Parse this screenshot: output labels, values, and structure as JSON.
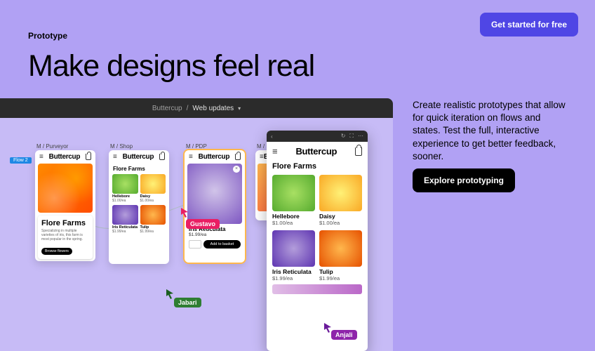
{
  "cta_top": "Get started for free",
  "eyebrow": "Prototype",
  "headline": "Make designs feel real",
  "description": "Create realistic prototypes that allow for quick iteration on flows and states. Test the full, interactive experience to get better feedback, sooner.",
  "cta_explore": "Explore prototyping",
  "canvas": {
    "breadcrumb_root": "Buttercup",
    "breadcrumb_sep": "/",
    "breadcrumb_page": "Web updates",
    "flow_badge": "Flow 2",
    "frames": {
      "purveyor": {
        "label": "M / Purveyor",
        "brand": "Buttercup",
        "card_title": "Flore Farms",
        "card_copy": "Specializing in multiple varieties of iris, this farm is most popular in the spring.",
        "card_cta": "Browse flowers"
      },
      "shop": {
        "label": "M / Shop",
        "brand": "Buttercup",
        "title": "Flore Farms",
        "items": [
          {
            "name": "Hellebore",
            "price": "$1.00/ea"
          },
          {
            "name": "Daisy",
            "price": "$1.00/ea"
          },
          {
            "name": "Iris Reticulata",
            "price": "$1.99/ea"
          },
          {
            "name": "Tulip",
            "price": "$1.99/ea"
          }
        ]
      },
      "pdp": {
        "label": "M / PDP",
        "brand": "Buttercup",
        "product": "Iris Reticulata",
        "price": "$1.99/ea",
        "add_label": "Add to basket"
      },
      "cutoff": {
        "label": "M /",
        "brand": "Bu"
      }
    },
    "cursors": {
      "gustavo": "Gustavo",
      "jabari": "Jabari",
      "anjali": "Anjali"
    }
  },
  "preview": {
    "brand": "Buttercup",
    "title": "Flore Farms",
    "items": [
      {
        "name": "Hellebore",
        "price": "$1.00/ea"
      },
      {
        "name": "Daisy",
        "price": "$1.00/ea"
      },
      {
        "name": "Iris Reticulata",
        "price": "$1.99/ea"
      },
      {
        "name": "Tulip",
        "price": "$1.99/ea"
      }
    ]
  }
}
